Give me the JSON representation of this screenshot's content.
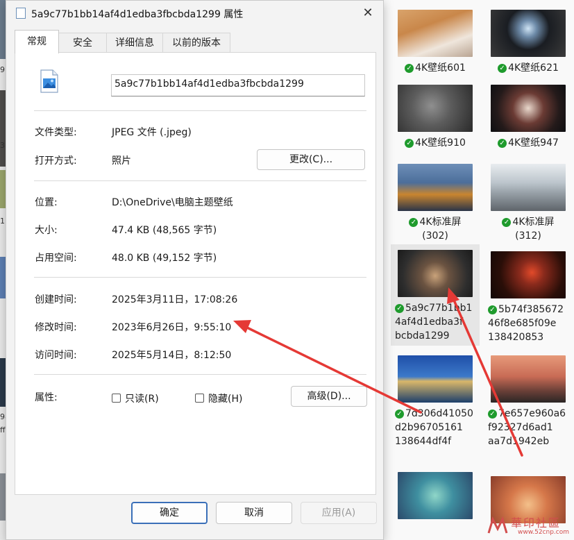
{
  "window": {
    "title": "5a9c77b1bb14af4d1edba3fbcbda1299 属性",
    "close_glyph": "✕"
  },
  "tabs": [
    "常规",
    "安全",
    "详细信息",
    "以前的版本"
  ],
  "file_name": "5a9c77b1bb14af4d1edba3fbcbda1299",
  "properties": {
    "type_label": "文件类型:",
    "type_value": "JPEG 文件 (.jpeg)",
    "open_label": "打开方式:",
    "open_value": "照片",
    "change_button": "更改(C)...",
    "location_label": "位置:",
    "location_value": "D:\\OneDrive\\电脑主题壁纸",
    "size_label": "大小:",
    "size_value": "47.4 KB (48,565 字节)",
    "disk_label": "占用空间:",
    "disk_value": "48.0 KB (49,152 字节)",
    "created_label": "创建时间:",
    "created_value": "2025年3月11日，17:08:26",
    "modified_label": "修改时间:",
    "modified_value": "2023年6月26日，9:55:10",
    "accessed_label": "访问时间:",
    "accessed_value": "2025年5月14日，8:12:50",
    "attr_label": "属性:",
    "readonly_label": "只读(R)",
    "hidden_label": "隐藏(H)",
    "advanced_button": "高级(D)..."
  },
  "buttons": {
    "ok": "确定",
    "cancel": "取消",
    "apply": "应用(A)"
  },
  "explorer": {
    "left_fragments": [
      "9",
      "3",
      "1",
      "98",
      "ff"
    ],
    "tiles": [
      {
        "lines": [
          "4K壁纸601"
        ],
        "check": true,
        "icon": "cats-thumbnail"
      },
      {
        "lines": [
          "4K壁纸621"
        ],
        "check": true,
        "icon": "tunnel-thumbnail"
      },
      {
        "lines": [
          "4K壁纸910"
        ],
        "check": true,
        "icon": "kitten-thumbnail"
      },
      {
        "lines": [
          "4K壁纸947"
        ],
        "check": true,
        "icon": "anime-girl-thumbnail"
      },
      {
        "lines": [
          "4K标准屏",
          "(302)"
        ],
        "check": true,
        "icon": "city-thumbnail"
      },
      {
        "lines": [
          "4K标准屏",
          "(312)"
        ],
        "check": true,
        "icon": "snow-road-thumbnail"
      },
      {
        "lines": [
          "5a9c77b1bb1",
          "4af4d1edba3f",
          "bcbda1299"
        ],
        "check": true,
        "icon": "pug-thumbnail"
      },
      {
        "lines": [
          "5b74f385672",
          "46f8e685f09e",
          "138420853"
        ],
        "check": true,
        "icon": "red-leaf-thumbnail"
      },
      {
        "lines": [
          "7d306d41050",
          "d2b96705161",
          "138644df4f"
        ],
        "check": true,
        "icon": "lake-thumbnail"
      },
      {
        "lines": [
          "7e657e960a6",
          "f92327d6ad1",
          "aa7d1942eb"
        ],
        "check": true,
        "icon": "street-thumbnail"
      },
      {
        "lines": [],
        "check": false,
        "icon": "anime-green-thumbnail"
      },
      {
        "lines": [],
        "check": false,
        "icon": "anime-orange-thumbnail"
      }
    ],
    "check_glyph": "✓"
  },
  "watermark": {
    "text": "華印社區",
    "url": "www.52cnp.com"
  },
  "colors": {
    "annotation_arrow": "#e53935",
    "check_green": "#1f9b2d",
    "primary_border": "#3a6fb8"
  }
}
